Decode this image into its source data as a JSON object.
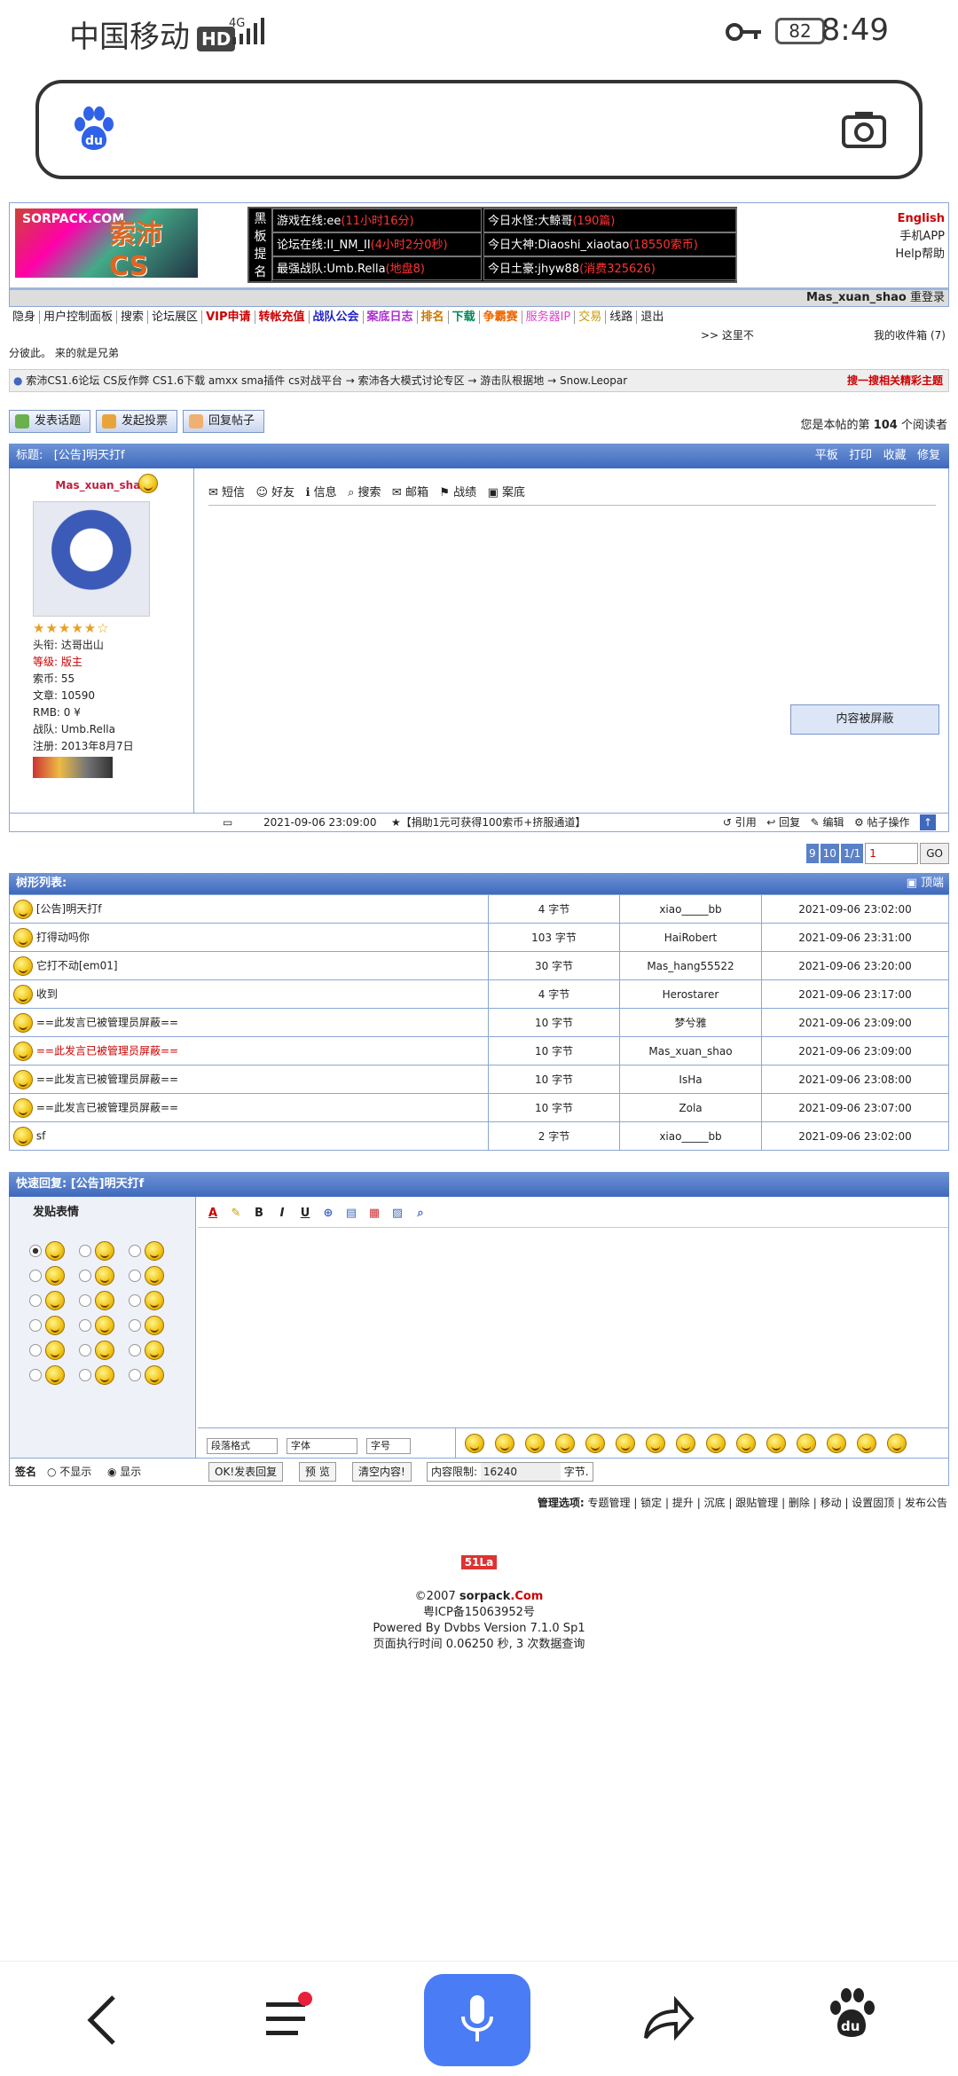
{
  "status": {
    "carrier": "中国移动",
    "hd": "HD",
    "net": "4G",
    "battery": "82",
    "time": "8:49"
  },
  "header": {
    "logo_top": "SORPACK.COM",
    "logo_title": "索沛CS",
    "board_label": "黑板提名",
    "board": [
      {
        "k": "游戏在线:ee",
        "v": "(11小时16分)"
      },
      {
        "k": "今日水怪:大鲸哥",
        "v": "(190篇)"
      },
      {
        "k": "论坛在线:II_NM_II",
        "v": "(4小时2分0秒)"
      },
      {
        "k": "今日大神:Diaoshi_xiaotao",
        "v": "(18550索币)"
      },
      {
        "k": "最强战队:Umb.Rella",
        "v": "(地盘8)"
      },
      {
        "k": "今日土豪:jhyw88",
        "v": "(消费325626)"
      }
    ],
    "right_links": [
      "English",
      "手机APP",
      "Help帮助"
    ],
    "username": "Mas_xuan_shao",
    "relogin": "重登录"
  },
  "menu": [
    "隐身",
    "用户控制面板",
    "搜索",
    "论坛展区",
    "VIP申请",
    "转帐充值",
    "战队公会",
    "案底日志",
    "排名",
    "下载",
    "争霸赛",
    "服务器IP",
    "交易",
    "线路",
    "退出"
  ],
  "here": ">> 这里不",
  "inbox": "我的收件箱 (7)",
  "tagline": "分彼此。 来的就是兄弟",
  "breadcrumb": "索沛CS1.6论坛 CS反作弊 CS1.6下载 amxx sma插件 cs对战平台 → 索沛各大模式讨论专区 → 游击队根据地 → Snow.Leopar",
  "search_related": "搜一搜相关精彩主题",
  "buttons": [
    "发表话题",
    "发起投票",
    "回复帖子"
  ],
  "reader_pre": "您是本帖的第",
  "reader_count": "104",
  "reader_post": "个阅读者",
  "thread": {
    "title_label": "标题:",
    "title": "[公告]明天打f",
    "actions": [
      "平板",
      "打印",
      "收藏",
      "修复"
    ]
  },
  "user": {
    "name": "Mas_xuan_shao",
    "info": [
      "头衔: 达哥出山",
      "等级: 版主",
      "索币: 55",
      "文章: 10590",
      "RMB: 0 ¥",
      "战队: Umb.Rella",
      "注册: 2013年8月7日"
    ]
  },
  "post_tools": [
    "短信",
    "好友",
    "信息",
    "搜索",
    "邮箱",
    "战绩",
    "案底"
  ],
  "shielded": "内容被屏蔽",
  "post_meta": {
    "time": "2021-09-06 23:09:00",
    "donate": "★【捐助1元可获得100索币+挤服通道】"
  },
  "post_actions": [
    "引用",
    "回复",
    "编辑",
    "帖子操作"
  ],
  "pager": [
    "9",
    "10",
    "1/1",
    "1"
  ],
  "go": "GO",
  "tree": {
    "title": "树形列表:",
    "top": "顶端",
    "rows": [
      {
        "t": "[公告]明天打f",
        "s": "4 字节",
        "u": "xiao_____bb",
        "d": "2021-09-06 23:02:00",
        "red": false
      },
      {
        "t": "打得动吗你",
        "s": "103 字节",
        "u": "HaiRobert",
        "d": "2021-09-06 23:31:00",
        "red": false
      },
      {
        "t": "它打不动[em01]",
        "s": "30 字节",
        "u": "Mas_hang55522",
        "d": "2021-09-06 23:20:00",
        "red": false
      },
      {
        "t": "收到",
        "s": "4 字节",
        "u": "Herostarer",
        "d": "2021-09-06 23:17:00",
        "red": false
      },
      {
        "t": "==此发言已被管理员屏蔽==",
        "s": "10 字节",
        "u": "梦兮雅",
        "d": "2021-09-06 23:09:00",
        "red": false
      },
      {
        "t": "==此发言已被管理员屏蔽==",
        "s": "10 字节",
        "u": "Mas_xuan_shao",
        "d": "2021-09-06 23:09:00",
        "red": true
      },
      {
        "t": "==此发言已被管理员屏蔽==",
        "s": "10 字节",
        "u": "IsHa",
        "d": "2021-09-06 23:08:00",
        "red": false
      },
      {
        "t": "==此发言已被管理员屏蔽==",
        "s": "10 字节",
        "u": "Zola",
        "d": "2021-09-06 23:07:00",
        "red": false
      },
      {
        "t": "sf",
        "s": "2 字节",
        "u": "xiao_____bb",
        "d": "2021-09-06 23:02:00",
        "red": false
      }
    ]
  },
  "quick": {
    "title": "快速回复: [公告]明天打f",
    "emoji_label": "发贴表情",
    "toolbar": [
      "A",
      "✎",
      "B",
      "I",
      "U"
    ],
    "selects": [
      "段落格式",
      "字体",
      "字号"
    ],
    "sign": "签名",
    "hide": "不显示",
    "show": "显示",
    "submit": "OK!发表回复",
    "preview": "预 览",
    "clear": "清空内容!",
    "limit_label": "内容限制:",
    "limit": "16240",
    "limit_unit": "字节."
  },
  "manage_label": "管理选项:",
  "manage": [
    "专题管理",
    "锁定",
    "提升",
    "沉底",
    "跟贴管理",
    "删除",
    "移动",
    "设置固顶",
    "发布公告"
  ],
  "footer": {
    "badge": "51La",
    "copy_pre": "©2007 ",
    "copy_site": "sorpack",
    "copy_com": ".Com",
    "icp": "粤ICP备15063952号",
    "powered": "Powered By Dvbbs Version 7.1.0 Sp1",
    "exec": "页面执行时间 0.06250 秒, 3 次数据查询"
  },
  "colors": {
    "accent": "#3f69bd",
    "red": "#cc0000",
    "nav_mic": "#4a7cf5"
  }
}
